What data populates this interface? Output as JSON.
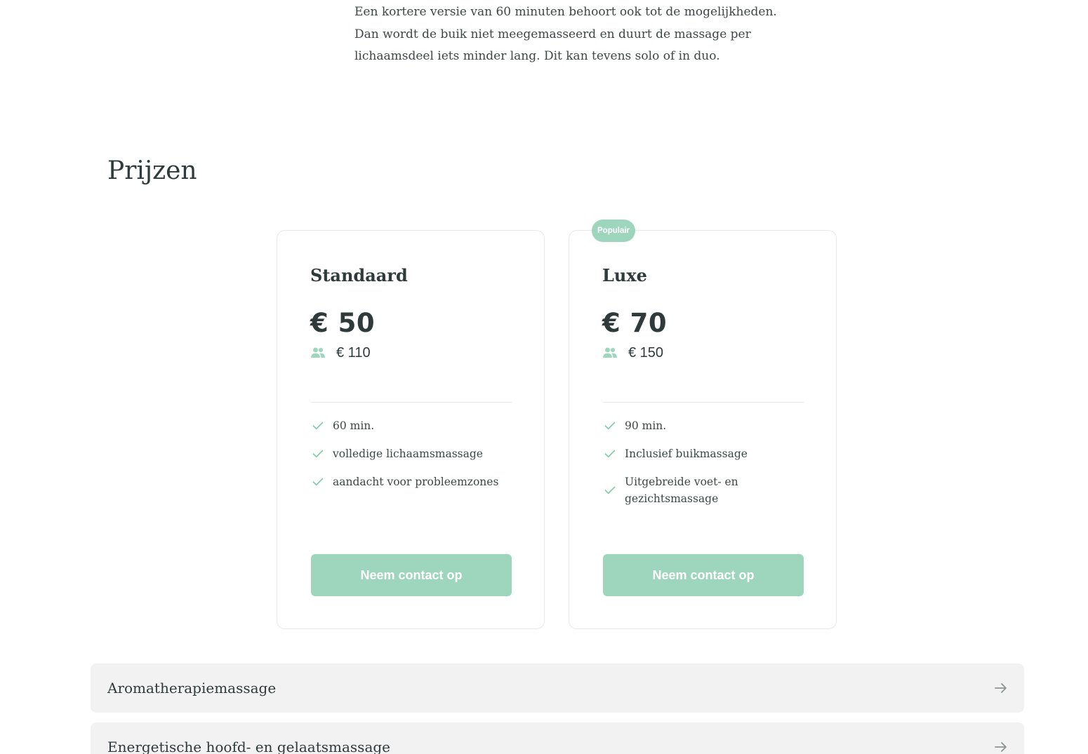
{
  "intro": {
    "text": "Een kortere versie van 60 minuten behoort ook tot de mogelijkheden. Dan wordt de buik niet meegemasseerd en duurt de massage per lichaamsdeel iets minder lang. Dit kan tevens solo of in duo."
  },
  "pricing": {
    "title": "Prijzen",
    "cards": [
      {
        "name": "Standaard",
        "price": "€ 50",
        "duo_icon": "people-icon",
        "duo_price": "€ 110",
        "features": [
          "60 min.",
          "volledige lichaamsmassage",
          "aandacht voor probleemzones"
        ],
        "cta": "Neem contact op"
      },
      {
        "badge": "Populair",
        "name": "Luxe",
        "price": "€ 70",
        "duo_icon": "people-icon",
        "duo_price": "€ 150",
        "features": [
          "90 min.",
          "Inclusief buikmassage",
          "Uitgebreide voet- en gezichtsmassage"
        ],
        "cta": "Neem contact op"
      }
    ]
  },
  "accordions": [
    {
      "label": "Aromatherapiemassage",
      "icon": "arrow-right-icon"
    },
    {
      "label": "Energetische hoofd- en gelaatsmassage",
      "icon": "arrow-right-icon"
    }
  ],
  "colors": {
    "accent": "#9ed5bd",
    "check": "#86cdb0",
    "text": "#2f3a3a",
    "accordion_bg": "#f2f2f2"
  }
}
